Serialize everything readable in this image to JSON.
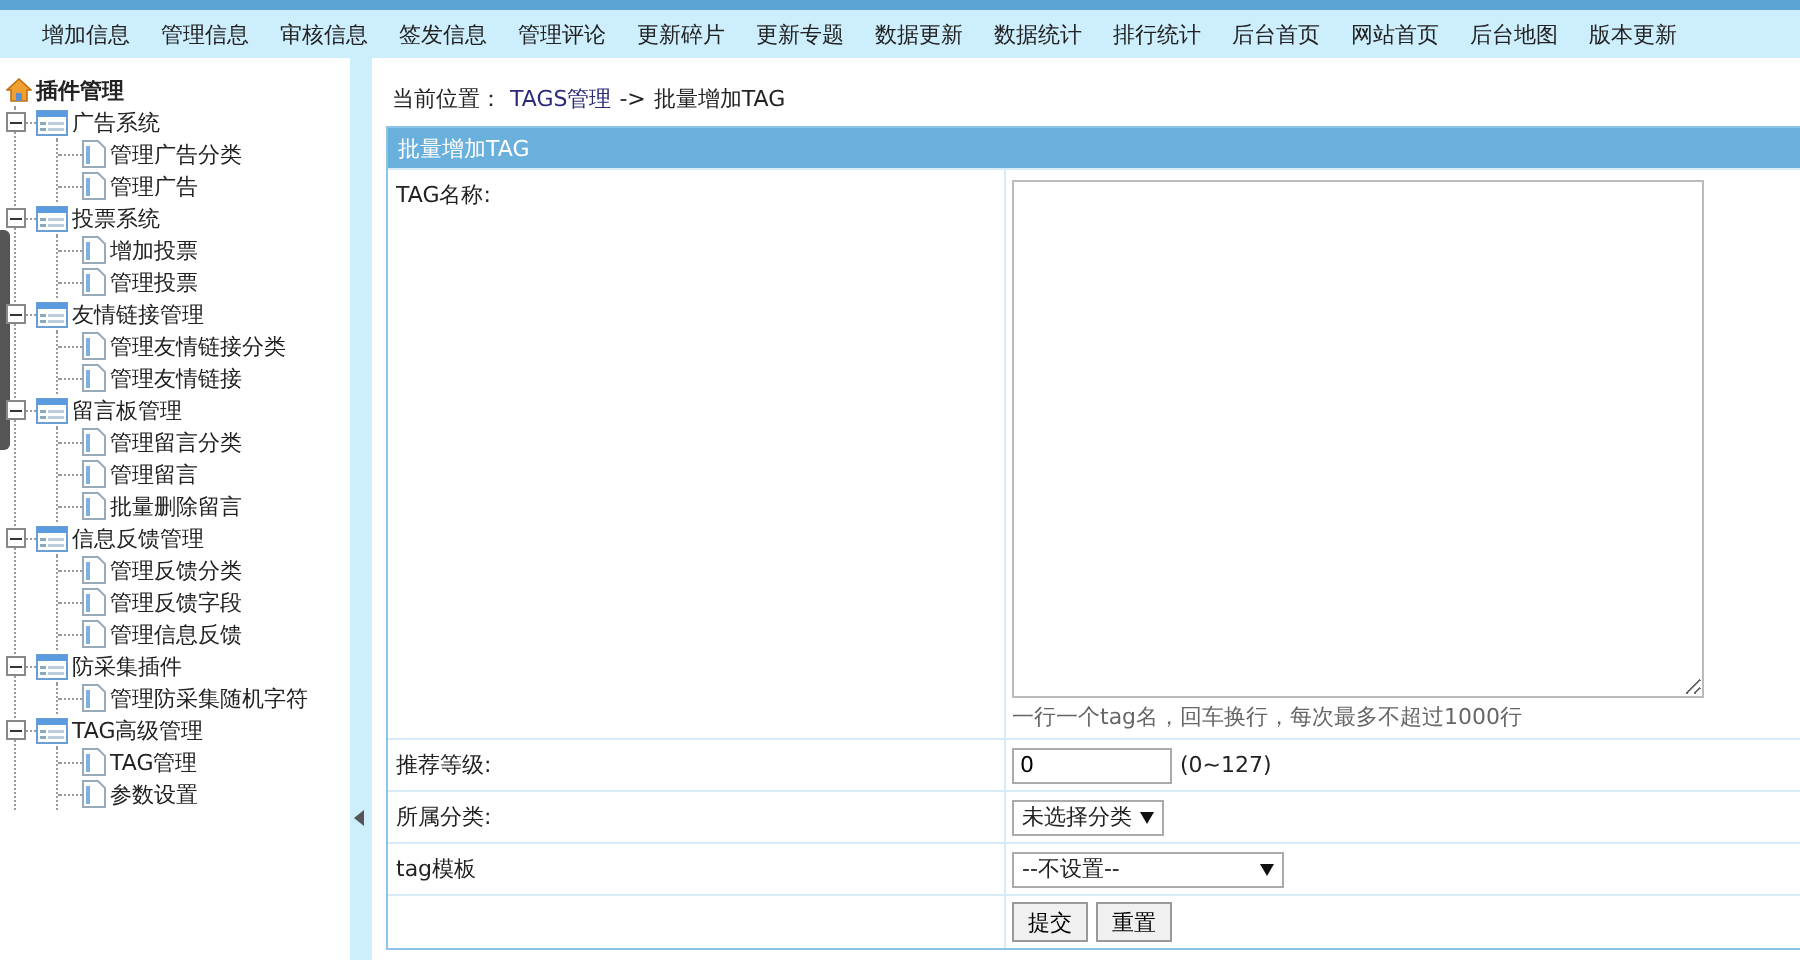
{
  "nav": {
    "items": [
      "增加信息",
      "管理信息",
      "审核信息",
      "签发信息",
      "管理评论",
      "更新碎片",
      "更新专题",
      "数据更新",
      "数据统计",
      "排行统计",
      "后台首页",
      "网站首页",
      "后台地图",
      "版本更新"
    ]
  },
  "sidebar": {
    "title": "插件管理",
    "groups": [
      {
        "label": "广告系统",
        "expanded": true,
        "children": [
          {
            "label": "管理广告分类"
          },
          {
            "label": "管理广告"
          }
        ]
      },
      {
        "label": "投票系统",
        "expanded": true,
        "children": [
          {
            "label": "增加投票"
          },
          {
            "label": "管理投票"
          }
        ]
      },
      {
        "label": "友情链接管理",
        "expanded": true,
        "children": [
          {
            "label": "管理友情链接分类"
          },
          {
            "label": "管理友情链接"
          }
        ]
      },
      {
        "label": "留言板管理",
        "expanded": true,
        "children": [
          {
            "label": "管理留言分类"
          },
          {
            "label": "管理留言"
          },
          {
            "label": "批量删除留言"
          }
        ]
      },
      {
        "label": "信息反馈管理",
        "expanded": true,
        "children": [
          {
            "label": "管理反馈分类"
          },
          {
            "label": "管理反馈字段"
          },
          {
            "label": "管理信息反馈"
          }
        ]
      },
      {
        "label": "防采集插件",
        "expanded": true,
        "children": [
          {
            "label": "管理防采集随机字符"
          }
        ]
      },
      {
        "label": "TAG高级管理",
        "expanded": true,
        "children": [
          {
            "label": "TAG管理"
          },
          {
            "label": "参数设置"
          }
        ]
      }
    ]
  },
  "breadcrumb": {
    "label": "当前位置：",
    "link": "TAGS管理",
    "separator": "->",
    "current": "批量增加TAG"
  },
  "form": {
    "title": "批量增加TAG",
    "rows": [
      {
        "kind": "textarea",
        "label": "TAG名称:",
        "hint": "一行一个tag名，回车换行，每次最多不超过1000行"
      },
      {
        "kind": "input",
        "label": "推荐等级:",
        "value": "0",
        "note": "(0~127)"
      },
      {
        "kind": "select",
        "label": "所属分类:",
        "value": "未选择分类"
      },
      {
        "kind": "select",
        "label": "tag模板",
        "value": "--不设置--"
      },
      {
        "kind": "buttons",
        "buttons": [
          "提交",
          "重置"
        ]
      }
    ]
  }
}
